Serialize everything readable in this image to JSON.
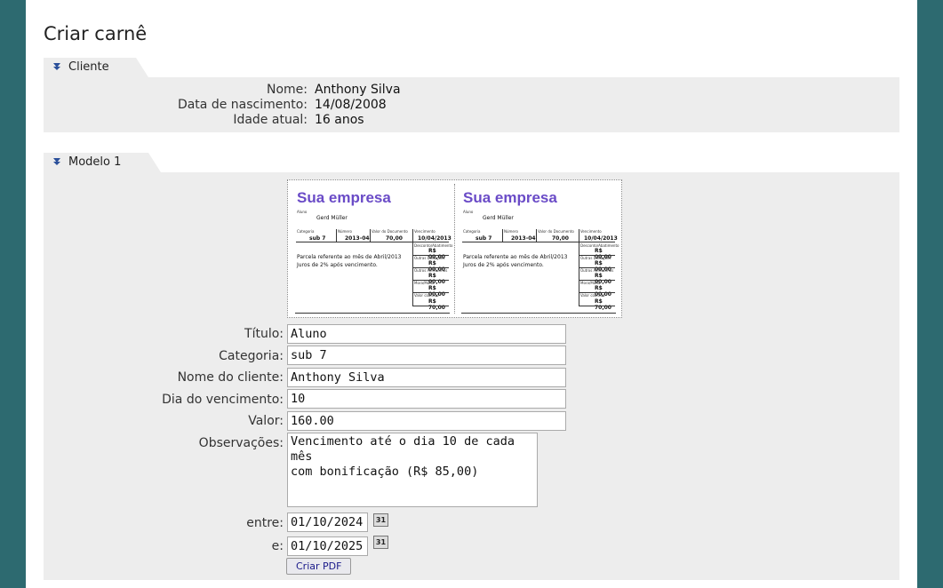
{
  "page": {
    "title": "Criar carnê"
  },
  "client_section": {
    "tab_label": "Cliente",
    "rows": [
      {
        "label": "Nome:",
        "value": "Anthony Silva"
      },
      {
        "label": "Data de nascimento:",
        "value": "14/08/2008"
      },
      {
        "label": "Idade atual:",
        "value": "16 anos"
      }
    ]
  },
  "model_section": {
    "tab_label": "Modelo 1",
    "preview": {
      "brand": "Sua empresa",
      "aluno_label": "Aluno",
      "student_name": "Gerd Müller",
      "col_categoria": "Categoria",
      "col_numero": "Número",
      "col_valor_doc": "Valor do Documento",
      "col_vencimento": "Vencimento",
      "categoria": "sub 7",
      "numero": "2013-04",
      "valor_doc": "70,00",
      "vencimento": "10/04/2013",
      "line1": "Parcela referente ao mês de Abril/2013",
      "line2": "Juros de 2% após vencimento.",
      "box_rows": [
        {
          "label": "Desconto/Abatimento",
          "value": "R$ 00,00"
        },
        {
          "label": "Outras Deduções",
          "value": "R$ 00,00"
        },
        {
          "label": "Outros Acréscimos",
          "value": "R$ 00,00"
        },
        {
          "label": "Mora/Multa",
          "value": "R$ 00,00"
        },
        {
          "label": "Valor cobrado",
          "value": "R$ 70,00"
        }
      ]
    },
    "fields": {
      "titulo": {
        "label": "Título:",
        "value": "Aluno"
      },
      "categoria": {
        "label": "Categoria:",
        "value": "sub 7"
      },
      "nome_cliente": {
        "label": "Nome do cliente:",
        "value": "Anthony Silva"
      },
      "dia_vencimento": {
        "label": "Dia do vencimento:",
        "value": "10"
      },
      "valor": {
        "label": "Valor:",
        "value": "160.00"
      },
      "observacoes": {
        "label": "Observações:",
        "value": "Vencimento até o dia 10 de cada mês\ncom bonificação (R$ 85,00)"
      },
      "entre": {
        "label": "entre:",
        "value": "01/10/2024"
      },
      "e": {
        "label": "e:",
        "value": "01/10/2025"
      }
    },
    "calendar_icon_text": "31",
    "pdf_button_label": "Criar PDF"
  },
  "colors": {
    "background": "#2d6a70",
    "panel": "#ededed",
    "brand": "#6a4bc7",
    "arrow": "#2a4f9a"
  }
}
